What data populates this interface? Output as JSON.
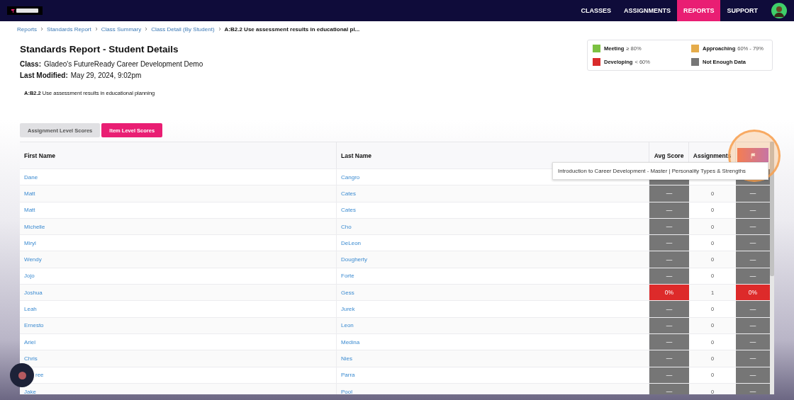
{
  "nav": {
    "items": [
      {
        "label": "CLASSES",
        "selected": false
      },
      {
        "label": "ASSIGNMENTS",
        "selected": false
      },
      {
        "label": "REPORTS",
        "selected": true
      },
      {
        "label": "SUPPORT",
        "selected": false
      }
    ]
  },
  "breadcrumbs": [
    "Reports",
    "Standards Report",
    "Class Summary",
    "Class Detail (By Student)",
    "A:B2.2 Use assessment results in educational pl..."
  ],
  "title": "Standards Report - Student Details",
  "meta": [
    {
      "label": "Class:",
      "value": "Gladeo's FutureReady Career Development Demo"
    },
    {
      "label": "Last Modified:",
      "value": "May 29, 2024, 9:02pm"
    }
  ],
  "standard": "**A:B2.2** Use assessment results in educational planning",
  "legend": [
    {
      "label": "Meeting",
      "range": "≥ 80%",
      "color": "#7cc142"
    },
    {
      "label": "Approaching",
      "range": "60% - 79%",
      "color": "#e5ac4b"
    },
    {
      "label": "Developing",
      "range": "< 60%",
      "color": "#d92b2b"
    },
    {
      "label": "Not Enough Data",
      "color": "#767676"
    }
  ],
  "tabs": [
    {
      "label": "Assignment Level Scores",
      "selected": false
    },
    {
      "label": "Item Level Scores",
      "selected": true
    }
  ],
  "table": {
    "columns": [
      "First Name",
      "Last Name",
      "Avg Score",
      "Assignments"
    ],
    "rows": [
      {
        "first_name": "Dane",
        "last_name": "Cangro",
        "avg": {
          "color": "#767676"
        },
        "item": {
          "color": "#767676"
        }
      },
      {
        "first_name": "Matt",
        "last_name": "Cates",
        "avg": {
          "text": "—",
          "color": "#767676"
        },
        "assignments": "0",
        "item": {
          "text": "—",
          "color": "#767676"
        }
      },
      {
        "first_name": "Matt",
        "last_name": "Cates",
        "avg": {
          "text": "—",
          "color": "#767676"
        },
        "assignments": "0",
        "item": {
          "text": "—",
          "color": "#767676"
        }
      },
      {
        "first_name": "Michelle",
        "last_name": "Cho",
        "avg": {
          "text": "—",
          "color": "#767676"
        },
        "assignments": "0",
        "item": {
          "text": "—",
          "color": "#767676"
        }
      },
      {
        "first_name": "Miryl",
        "last_name": "DeLeon",
        "avg": {
          "text": "—",
          "color": "#767676"
        },
        "assignments": "0",
        "item": {
          "text": "—",
          "color": "#767676"
        }
      },
      {
        "first_name": "Wendy",
        "last_name": "Dougherty",
        "avg": {
          "text": "—",
          "color": "#767676"
        },
        "assignments": "0",
        "item": {
          "text": "—",
          "color": "#767676"
        }
      },
      {
        "first_name": "Jojo",
        "last_name": "Forte",
        "avg": {
          "text": "—",
          "color": "#767676"
        },
        "assignments": "0",
        "item": {
          "text": "—",
          "color": "#767676"
        }
      },
      {
        "first_name": "Joshua",
        "last_name": "Gess",
        "avg": {
          "text": "0%",
          "color": "#dd2a2a"
        },
        "assignments": "1",
        "item": {
          "text": "0%",
          "color": "#dd2a2a"
        }
      },
      {
        "first_name": "Leah",
        "last_name": "Jurek",
        "avg": {
          "text": "—",
          "color": "#767676"
        },
        "assignments": "0",
        "item": {
          "text": "—",
          "color": "#767676"
        }
      },
      {
        "first_name": "Ernesto",
        "last_name": "Leon",
        "avg": {
          "text": "—",
          "color": "#767676"
        },
        "assignments": "0",
        "item": {
          "text": "—",
          "color": "#767676"
        }
      },
      {
        "first_name": "Ariel",
        "last_name": "Medina",
        "avg": {
          "text": "—",
          "color": "#767676"
        },
        "assignments": "0",
        "item": {
          "text": "—",
          "color": "#767676"
        }
      },
      {
        "first_name": "Chris",
        "last_name": "Nies",
        "avg": {
          "text": "—",
          "color": "#767676"
        },
        "assignments": "0",
        "item": {
          "text": "—",
          "color": "#767676"
        }
      },
      {
        "first_name": "ree",
        "covered": true,
        "last_name": "Parra",
        "avg": {
          "text": "—",
          "color": "#767676"
        },
        "assignments": "0",
        "item": {
          "text": "—",
          "color": "#767676"
        }
      },
      {
        "first_name": "Jake",
        "last_name": "Pool",
        "avg": {
          "text": "—",
          "color": "#767676"
        },
        "assignments": "0",
        "item": {
          "text": "—",
          "color": "#767676"
        }
      }
    ]
  },
  "tooltip": "Introduction to Career Development - Master | Personality Types & Strengths"
}
